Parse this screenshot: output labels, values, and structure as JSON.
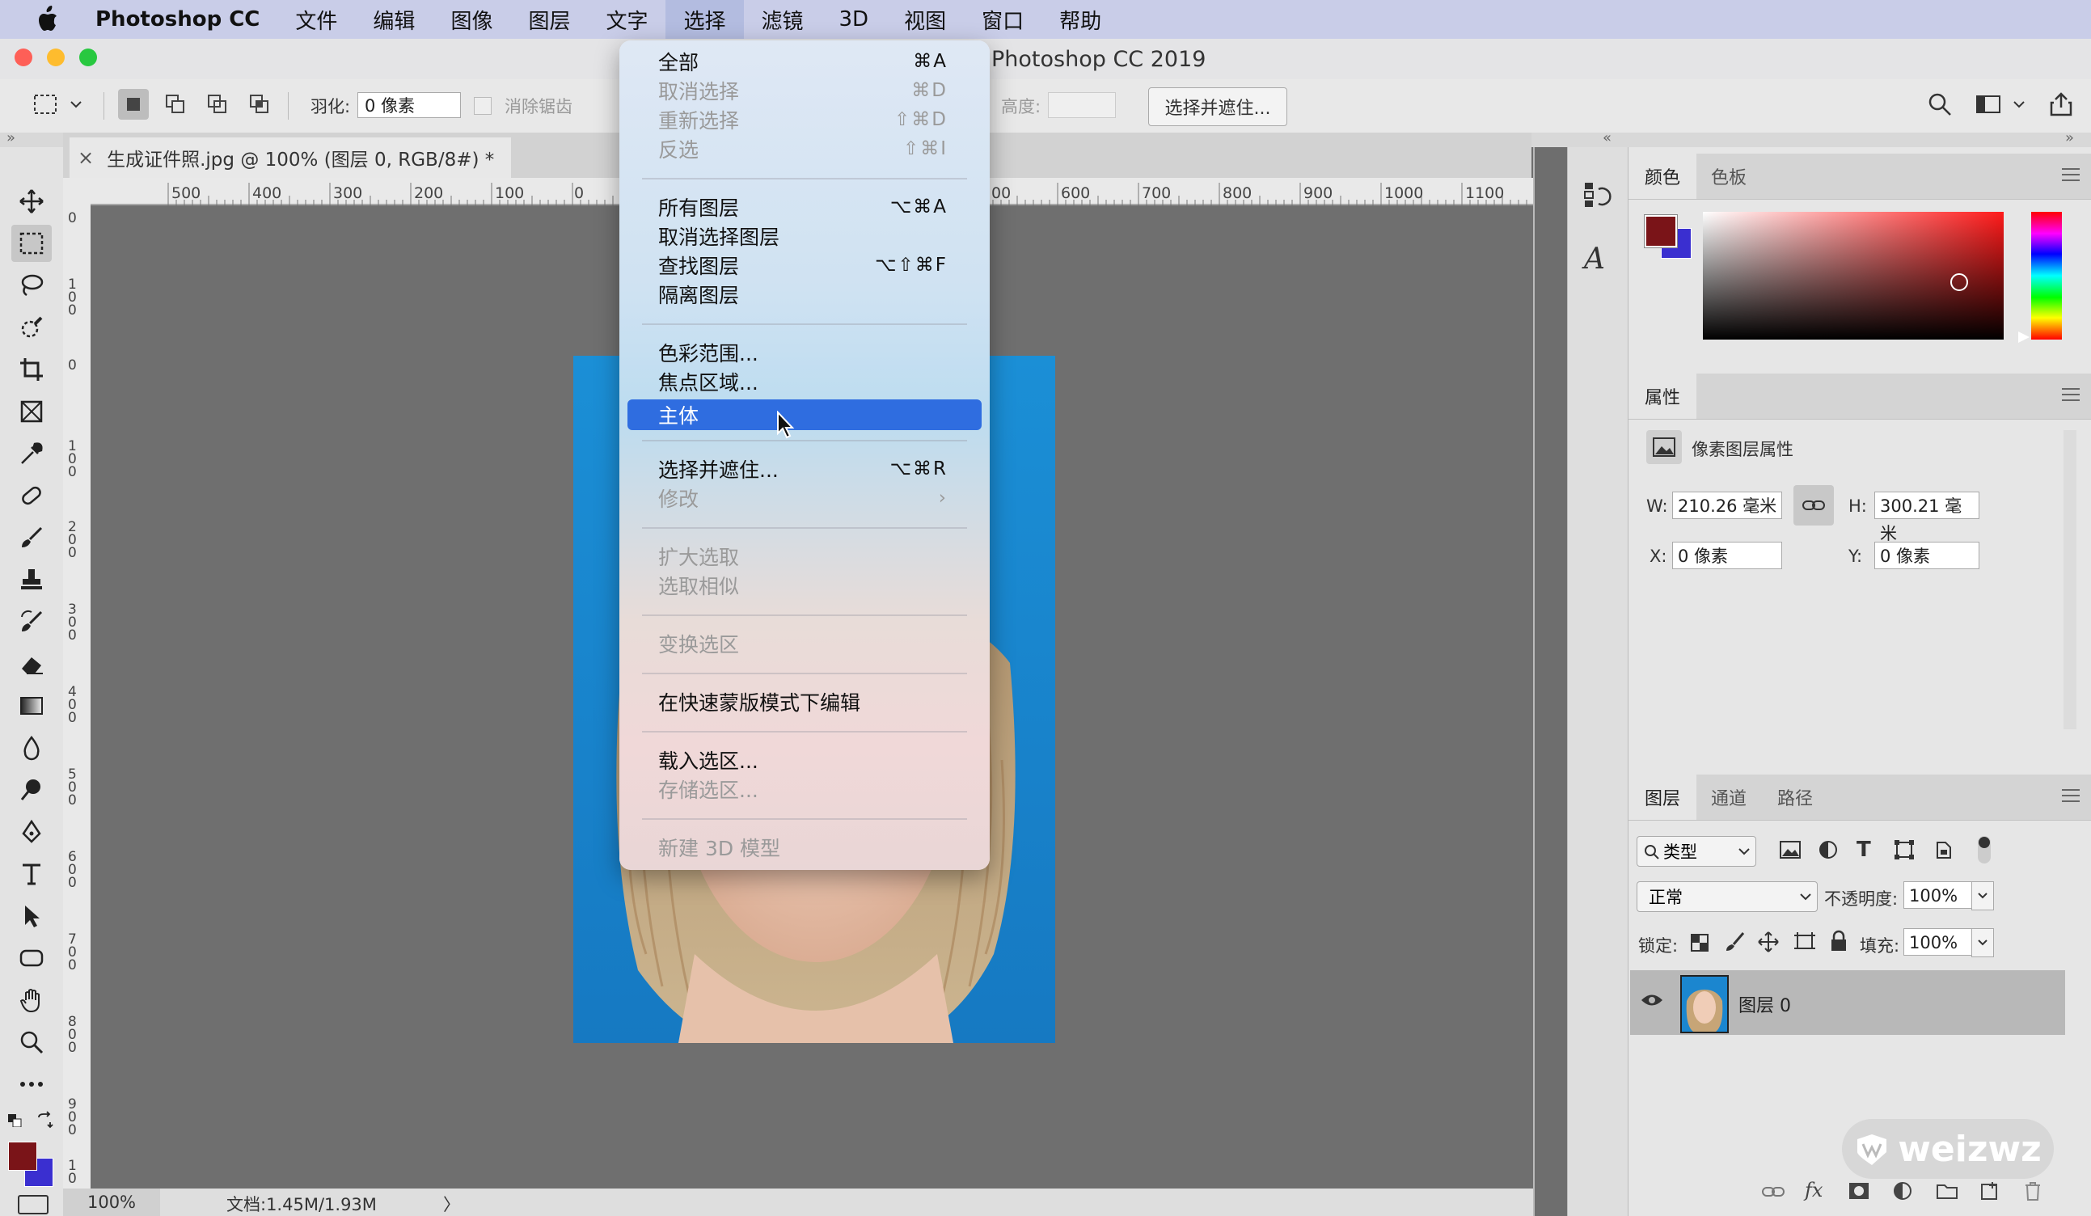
{
  "menubar": {
    "app": "Photoshop CC",
    "items": [
      "文件",
      "编辑",
      "图像",
      "图层",
      "文字",
      "选择",
      "滤镜",
      "3D",
      "视图",
      "窗口",
      "帮助"
    ],
    "active": "选择"
  },
  "window": {
    "title": "Photoshop CC 2019"
  },
  "options": {
    "feather_label": "羽化:",
    "feather_value": "0 像素",
    "antialias_label": "消除锯齿",
    "height_label": "高度:",
    "select_mask_button": "选择并遮住..."
  },
  "document": {
    "tab_title": "生成证件照.jpg @ 100% (图层 0, RGB/8#) *",
    "close_glyph": "×"
  },
  "ruler": {
    "h_ticks": [
      "500",
      "400",
      "300",
      "200",
      "100",
      "0",
      "00",
      "600",
      "700",
      "800",
      "900",
      "1000",
      "1100"
    ],
    "v_ticks": [
      "0",
      "1 0 0",
      "0",
      "1 0 0",
      "2 0 0",
      "3 0 0",
      "4 0 0",
      "5 0 0",
      "6 0 0",
      "7 0 0",
      "8 0 0",
      "9 0 0",
      "1 0"
    ]
  },
  "status": {
    "zoom": "100%",
    "doc_info": "文档:1.45M/1.93M",
    "arrow": "〉"
  },
  "select_menu": {
    "items": [
      {
        "label": "全部",
        "shortcut": "⌘A",
        "disabled": false
      },
      {
        "label": "取消选择",
        "shortcut": "⌘D",
        "disabled": true
      },
      {
        "label": "重新选择",
        "shortcut": "⇧⌘D",
        "disabled": true
      },
      {
        "label": "反选",
        "shortcut": "⇧⌘I",
        "disabled": true
      },
      {
        "label": "所有图层",
        "shortcut": "⌥⌘A",
        "disabled": false
      },
      {
        "label": "取消选择图层",
        "shortcut": "",
        "disabled": false
      },
      {
        "label": "查找图层",
        "shortcut": "⌥⇧⌘F",
        "disabled": false
      },
      {
        "label": "隔离图层",
        "shortcut": "",
        "disabled": false
      },
      {
        "label": "色彩范围...",
        "shortcut": "",
        "disabled": false
      },
      {
        "label": "焦点区域...",
        "shortcut": "",
        "disabled": false
      },
      {
        "label": "主体",
        "shortcut": "",
        "disabled": false,
        "highlighted": true
      },
      {
        "label": "选择并遮住...",
        "shortcut": "⌥⌘R",
        "disabled": false
      },
      {
        "label": "修改",
        "shortcut": "›",
        "disabled": true
      },
      {
        "label": "扩大选取",
        "shortcut": "",
        "disabled": true
      },
      {
        "label": "选取相似",
        "shortcut": "",
        "disabled": true
      },
      {
        "label": "变换选区",
        "shortcut": "",
        "disabled": true
      },
      {
        "label": "在快速蒙版模式下编辑",
        "shortcut": "",
        "disabled": false
      },
      {
        "label": "载入选区...",
        "shortcut": "",
        "disabled": false
      },
      {
        "label": "存储选区...",
        "shortcut": "",
        "disabled": true
      },
      {
        "label": "新建 3D 模型",
        "shortcut": "",
        "disabled": true
      }
    ]
  },
  "color_panel": {
    "tabs": [
      "颜色",
      "色板"
    ],
    "foreground": "#7a1418",
    "background": "#3a2fd0"
  },
  "properties_panel": {
    "tab": "属性",
    "header": "像素图层属性",
    "w_label": "W:",
    "w_value": "210.26 毫米",
    "h_label": "H:",
    "h_value": "300.21 毫米",
    "x_label": "X:",
    "x_value": "0 像素",
    "y_label": "Y:",
    "y_value": "0 像素"
  },
  "layers_panel": {
    "tabs": [
      "图层",
      "通道",
      "路径"
    ],
    "filter_label": "类型",
    "blend_mode": "正常",
    "opacity_label": "不透明度:",
    "opacity_value": "100%",
    "lock_label": "锁定:",
    "fill_label": "填充:",
    "fill_value": "100%",
    "layer_name": "图层 0"
  },
  "watermark": "weizwz"
}
